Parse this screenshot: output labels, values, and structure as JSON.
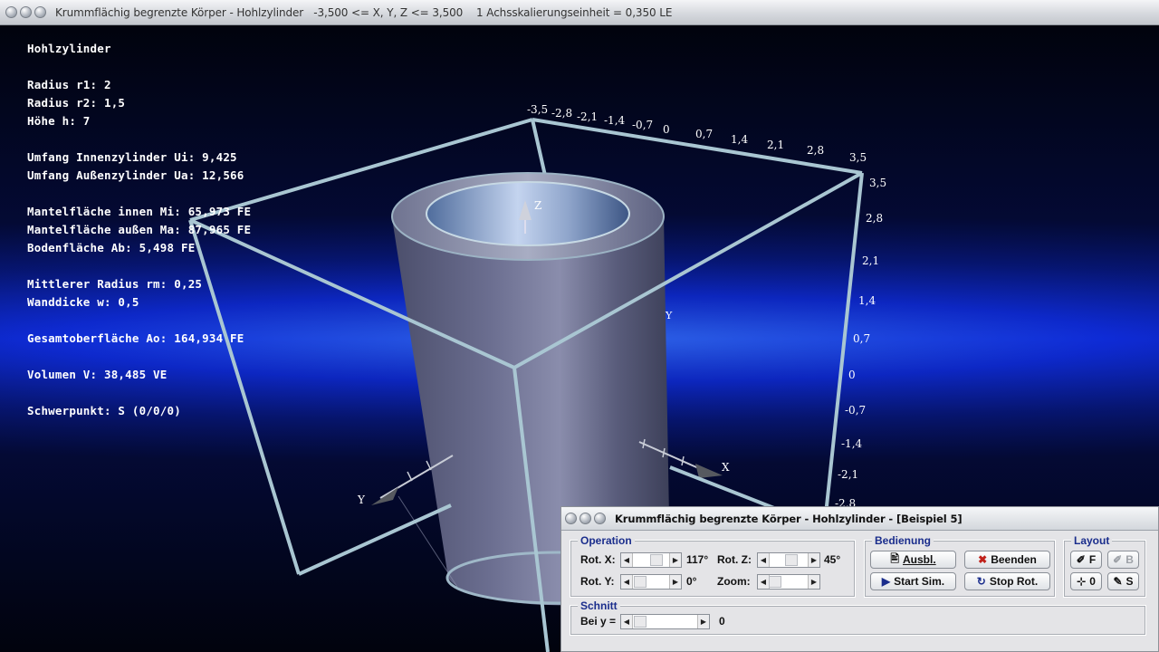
{
  "window": {
    "title": "Krummflächig begrenzte Körper - Hohlzylinder   -3,500 <= X, Y, Z <= 3,500    1 Achsskalierungseinheit = 0,350 LE"
  },
  "info": {
    "title": "Hohlzylinder",
    "r1": "Radius r1: 2",
    "r2": "Radius r2: 1,5",
    "h": "Höhe h: 7",
    "ui": "Umfang Innenzylinder Ui: 9,425",
    "ua": "Umfang Außenzylinder Ua: 12,566",
    "mi": "Mantelfläche innen Mi: 65,973 FE",
    "ma": "Mantelfläche außen Ma: 87,965 FE",
    "ab": "Bodenfläche Ab: 5,498 FE",
    "rm": "Mittlerer Radius rm: 0,25",
    "w": "Wanddicke w: 0,5",
    "ao": "Gesamtoberfläche Ao: 164,934 FE",
    "v": "Volumen V: 38,485 VE",
    "s": "Schwerpunkt: S (0/0/0)"
  },
  "scene": {
    "top_ticks": [
      "-3,5",
      "-2,8",
      "-2,1",
      "-1,4",
      "-0,7",
      "0",
      "0,7",
      "1,4",
      "2,1",
      "2,8",
      "3,5"
    ],
    "side_ticks": [
      "3,5",
      "2,8",
      "2,1",
      "1,4",
      "0,7",
      "0",
      "-0,7",
      "-1,4",
      "-2,1",
      "-2,8"
    ],
    "axis_x": "X",
    "axis_y": "Y",
    "axis_z": "Z"
  },
  "panel": {
    "title": "Krummflächig begrenzte Körper - Hohlzylinder - [Beispiel 5]",
    "operation": {
      "legend": "Operation",
      "rotx_label": "Rot. X:",
      "rotx_value": "117°",
      "rotz_label": "Rot. Z:",
      "rotz_value": "45°",
      "roty_label": "Rot. Y:",
      "roty_value": "0°",
      "zoom_label": "Zoom:"
    },
    "bedienung": {
      "legend": "Bedienung",
      "ausbl": "Ausbl.",
      "beenden": "Beenden",
      "start": "Start Sim.",
      "stop": "Stop Rot."
    },
    "layout": {
      "legend": "Layout",
      "f": "F",
      "b": "B",
      "o": "0",
      "s": "S"
    },
    "schnitt": {
      "legend": "Schnitt",
      "label": "Bei y =",
      "value": "0"
    }
  }
}
